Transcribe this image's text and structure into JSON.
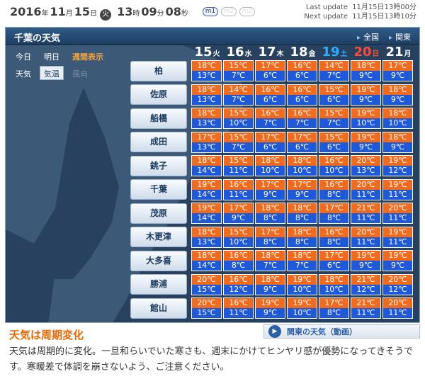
{
  "header": {
    "year": "2016",
    "month": "11",
    "day": "15",
    "dow": "火",
    "hour": "13",
    "minute": "09",
    "second": "08",
    "unit_year": "年",
    "unit_month": "月",
    "unit_day": "日",
    "unit_hour": "時",
    "unit_minute": "分",
    "unit_second": "秒",
    "pills": [
      "m1",
      "m2",
      "m3"
    ],
    "last_update_label": "Last update",
    "last_update_value": "11月15日13時00分",
    "next_update_label": "Next update",
    "next_update_value": "11月15日13時10分"
  },
  "panel": {
    "title": "千葉の天気",
    "link_national": "全国",
    "link_kanto": "関東"
  },
  "tabs": {
    "today": "今日",
    "tomorrow": "明日",
    "weekly": "週間表示",
    "weather": "天気",
    "temperature": "気温",
    "wind": "風向"
  },
  "days": [
    {
      "date": "15",
      "weekday": "火",
      "type": "weekday"
    },
    {
      "date": "16",
      "weekday": "水",
      "type": "weekday"
    },
    {
      "date": "17",
      "weekday": "木",
      "type": "weekday"
    },
    {
      "date": "18",
      "weekday": "金",
      "type": "weekday"
    },
    {
      "date": "19",
      "weekday": "土",
      "type": "sat"
    },
    {
      "date": "20",
      "weekday": "日",
      "type": "sun"
    },
    {
      "date": "21",
      "weekday": "月",
      "type": "weekday"
    }
  ],
  "cities": [
    {
      "name": "柏",
      "hi": [
        "18℃",
        "15℃",
        "17℃",
        "16℃",
        "14℃",
        "18℃",
        "17℃"
      ],
      "lo": [
        "13℃",
        "7℃",
        "6℃",
        "6℃",
        "7℃",
        "9℃",
        "9℃"
      ]
    },
    {
      "name": "佐原",
      "hi": [
        "18℃",
        "14℃",
        "16℃",
        "16℃",
        "15℃",
        "19℃",
        "18℃"
      ],
      "lo": [
        "13℃",
        "7℃",
        "6℃",
        "6℃",
        "6℃",
        "9℃",
        "9℃"
      ]
    },
    {
      "name": "船橋",
      "hi": [
        "18℃",
        "15℃",
        "16℃",
        "16℃",
        "15℃",
        "19℃",
        "18℃"
      ],
      "lo": [
        "13℃",
        "10℃",
        "7℃",
        "7℃",
        "7℃",
        "10℃",
        "10℃"
      ]
    },
    {
      "name": "成田",
      "hi": [
        "17℃",
        "15℃",
        "17℃",
        "17℃",
        "15℃",
        "19℃",
        "18℃"
      ],
      "lo": [
        "13℃",
        "7℃",
        "6℃",
        "6℃",
        "6℃",
        "9℃",
        "9℃"
      ]
    },
    {
      "name": "銚子",
      "hi": [
        "18℃",
        "15℃",
        "18℃",
        "18℃",
        "16℃",
        "20℃",
        "19℃"
      ],
      "lo": [
        "14℃",
        "11℃",
        "10℃",
        "10℃",
        "10℃",
        "13℃",
        "12℃"
      ]
    },
    {
      "name": "千葉",
      "hi": [
        "19℃",
        "16℃",
        "17℃",
        "17℃",
        "16℃",
        "20℃",
        "19℃"
      ],
      "lo": [
        "14℃",
        "11℃",
        "9℃",
        "9℃",
        "8℃",
        "11℃",
        "11℃"
      ]
    },
    {
      "name": "茂原",
      "hi": [
        "19℃",
        "17℃",
        "18℃",
        "18℃",
        "17℃",
        "21℃",
        "20℃"
      ],
      "lo": [
        "14℃",
        "9℃",
        "8℃",
        "8℃",
        "8℃",
        "11℃",
        "11℃"
      ]
    },
    {
      "name": "木更津",
      "hi": [
        "18℃",
        "15℃",
        "17℃",
        "18℃",
        "16℃",
        "20℃",
        "19℃"
      ],
      "lo": [
        "13℃",
        "10℃",
        "8℃",
        "8℃",
        "8℃",
        "11℃",
        "11℃"
      ]
    },
    {
      "name": "大多喜",
      "hi": [
        "18℃",
        "16℃",
        "18℃",
        "18℃",
        "17℃",
        "19℃",
        "19℃"
      ],
      "lo": [
        "14℃",
        "8℃",
        "7℃",
        "7℃",
        "6℃",
        "9℃",
        "9℃"
      ]
    },
    {
      "name": "勝浦",
      "hi": [
        "20℃",
        "16℃",
        "18℃",
        "19℃",
        "18℃",
        "21℃",
        "20℃"
      ],
      "lo": [
        "15℃",
        "12℃",
        "9℃",
        "10℃",
        "10℃",
        "12℃",
        "12℃"
      ]
    },
    {
      "name": "館山",
      "hi": [
        "20℃",
        "16℃",
        "19℃",
        "19℃",
        "17℃",
        "21℃",
        "20℃"
      ],
      "lo": [
        "15℃",
        "11℃",
        "9℃",
        "10℃",
        "8℃",
        "11℃",
        "11℃"
      ]
    }
  ],
  "comment": {
    "title": "天気は周期変化",
    "video_label": "関東の天気（動画）",
    "body": "天気は周期的に変化。一旦和らいでいた寒さも、週末にかけてヒンヤリ感が優勢になってきそうです。寒暖差で体調を崩さないよう、ご注意ください。"
  },
  "colors": {
    "hi_temp": "#f26b1d",
    "lo_temp": "#1e59d9",
    "saturday": "#2fb0ff",
    "sunday": "#ff4a3a",
    "accent_orange": "#e66a00",
    "map_sea": "#27415e",
    "map_land": "#3c5a78"
  },
  "icons": {
    "play": "play-icon",
    "link_arrow": "triangle-right-icon"
  }
}
